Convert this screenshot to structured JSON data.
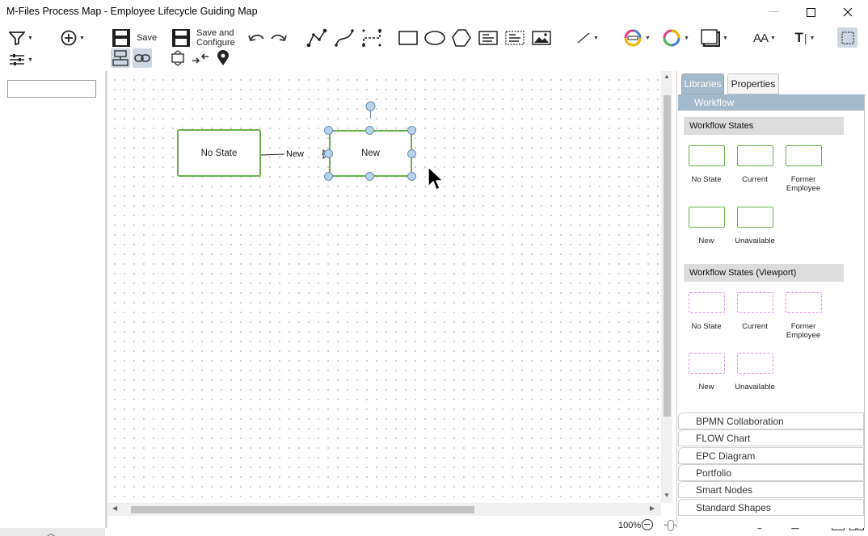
{
  "window": {
    "title": "M-Files Process Map - Employee Lifecycle Guiding Map",
    "minimize_icon": "minimize-icon",
    "maximize_icon": "maximize-icon",
    "close_icon": "close-icon"
  },
  "toolbar": {
    "save_label": "Save",
    "save_configure_line1": "Save and",
    "save_configure_line2": "Configure",
    "font_size_label": "AA",
    "text_tool_label": "T",
    "icons": [
      "filter-icon",
      "add-circle-icon",
      "settings-sliders-icon",
      "save-icon",
      "undo-icon",
      "redo-icon",
      "polyline-connector-icon",
      "curved-connector-icon",
      "orthogonal-connector-icon",
      "rectangle-icon",
      "ellipse-icon",
      "polygon-icon",
      "text-box-icon",
      "text-frame-icon",
      "image-icon",
      "line-style-icon",
      "line-color-icon",
      "fill-color-icon",
      "shadow-icon",
      "font-size-icon",
      "text-tool-icon",
      "snap-grid-icon",
      "layout-icon",
      "link-icon",
      "expand-icon",
      "collapse-icon",
      "location-pin-icon"
    ]
  },
  "left_panel": {
    "search_value": ""
  },
  "diagram": {
    "states": [
      {
        "label": "No State"
      },
      {
        "label": "New"
      }
    ],
    "transition_label": "New"
  },
  "right_panel": {
    "tabs": [
      {
        "label": "Libraries",
        "active": true
      },
      {
        "label": "Properties",
        "active": false
      }
    ],
    "library_header": "Workflow",
    "sections": [
      {
        "title": "Workflow States",
        "style": "solid",
        "items": [
          "No State",
          "Current",
          "Former Employee",
          "New",
          "Unavailable"
        ]
      },
      {
        "title": "Workflow States (Viewport)",
        "style": "dashed",
        "items": [
          "No State",
          "Current",
          "Former Employee",
          "New",
          "Unavailable"
        ]
      }
    ],
    "libraries": [
      "BPMN Collaboration",
      "FLOW Chart",
      "EPC Diagram",
      "Portfolio",
      "Smart Nodes",
      "Standard Shapes"
    ]
  },
  "status_bar": {
    "zoom": "100%",
    "zoom_slider_fraction": 0.0,
    "icons": [
      "zoom-in-icon",
      "zoom-100-icon",
      "fit-page-icon",
      "zoom-selection-icon",
      "single-page-icon",
      "two-page-icon"
    ]
  },
  "colors": {
    "state_border": "#6ab04c",
    "viewport_border": "#e58ee5",
    "panel_accent": "#a3b9cc"
  }
}
